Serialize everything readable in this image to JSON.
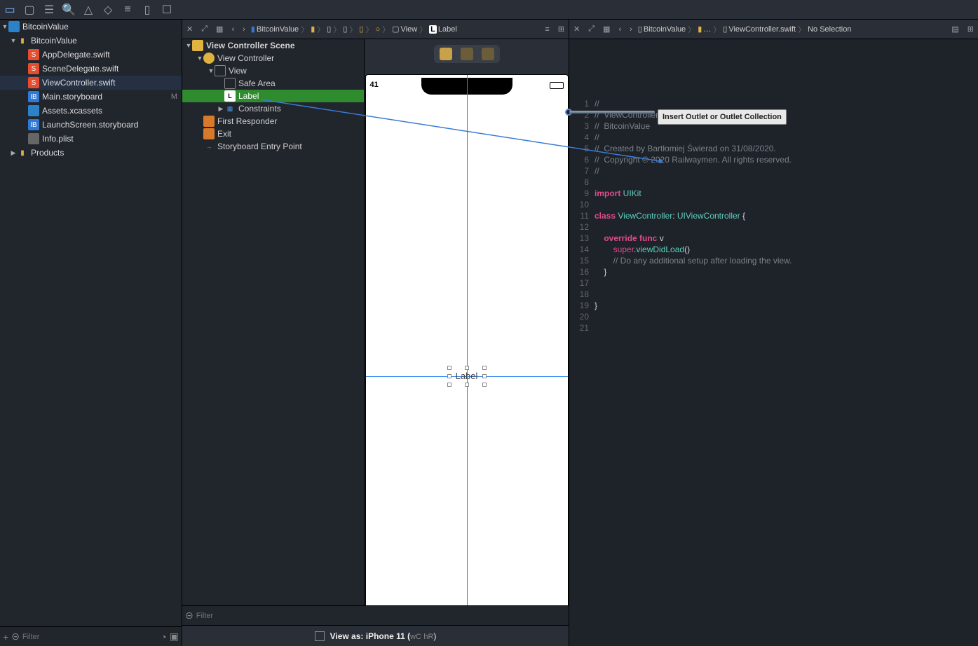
{
  "toolbar": {
    "icons": [
      "run-icon",
      "grid-icon",
      "hierarchy-icon",
      "search-icon",
      "warning-icon",
      "diamond-icon",
      "lines-icon",
      "box-icon",
      "chat-icon"
    ]
  },
  "navigator": {
    "project": "BitcoinValue",
    "groups": [
      {
        "name": "BitcoinValue",
        "expanded": true,
        "children": [
          {
            "name": "AppDelegate.swift",
            "kind": "swift"
          },
          {
            "name": "SceneDelegate.swift",
            "kind": "swift"
          },
          {
            "name": "ViewController.swift",
            "kind": "swift",
            "selected": true
          },
          {
            "name": "Main.storyboard",
            "kind": "xib",
            "status": "M"
          },
          {
            "name": "Assets.xcassets",
            "kind": "assets"
          },
          {
            "name": "LaunchScreen.storyboard",
            "kind": "xib"
          },
          {
            "name": "Info.plist",
            "kind": "plist"
          }
        ]
      },
      {
        "name": "Products",
        "expanded": false
      }
    ],
    "filter_placeholder": "Filter"
  },
  "ib": {
    "crumbs": [
      "BitcoinValue",
      "",
      "",
      "",
      "",
      "",
      "",
      "View",
      "Label"
    ],
    "outline": {
      "scene": "View Controller Scene",
      "vc": "View Controller",
      "view": "View",
      "safe": "Safe Area",
      "label": "Label",
      "constraints": "Constraints",
      "first_responder": "First Responder",
      "exit": "Exit",
      "entry": "Storyboard Entry Point"
    },
    "device_clock": "41",
    "label_text": "Label",
    "bottom": {
      "viewas": "View as: iPhone 11 (",
      "wc": "wC",
      "hr": "hR",
      "close": ")"
    },
    "filter_placeholder": "Filter"
  },
  "editor": {
    "crumbs": [
      "BitcoinValue",
      "…",
      "",
      "ViewController.swift",
      "No Selection"
    ],
    "lines": [
      {
        "n": 1,
        "t": "//",
        "cls": "comment"
      },
      {
        "n": 2,
        "t": "//  ViewController.swift",
        "cls": "comment"
      },
      {
        "n": 3,
        "t": "//  BitcoinValue",
        "cls": "comment"
      },
      {
        "n": 4,
        "t": "//",
        "cls": "comment"
      },
      {
        "n": 5,
        "t": "//  Created by Bartłomiej Świerad on 31/08/2020.",
        "cls": "comment"
      },
      {
        "n": 6,
        "t": "//  Copyright © 2020 Railwaymen. All rights reserved.",
        "cls": "comment"
      },
      {
        "n": 7,
        "t": "//",
        "cls": "comment"
      },
      {
        "n": 8,
        "t": "",
        "cls": "plain"
      },
      {
        "n": 9,
        "seg": [
          [
            "import ",
            "keyword"
          ],
          [
            "UIKit",
            "type"
          ]
        ]
      },
      {
        "n": 10,
        "t": "",
        "cls": "plain"
      },
      {
        "n": 11,
        "seg": [
          [
            "class ",
            "keyword"
          ],
          [
            "ViewController",
            "type"
          ],
          [
            ": ",
            "plain"
          ],
          [
            "UIViewController",
            "type"
          ],
          [
            " {",
            "plain"
          ]
        ]
      },
      {
        "n": 12,
        "t": "",
        "cls": "plain"
      },
      {
        "n": 13,
        "seg": [
          [
            "    override func ",
            "keyword"
          ],
          [
            "v",
            "plain"
          ]
        ]
      },
      {
        "n": 14,
        "seg": [
          [
            "        ",
            "plain"
          ],
          [
            "super",
            "super"
          ],
          [
            ".",
            "plain"
          ],
          [
            "viewDidLoad",
            "func"
          ],
          [
            "()",
            "plain"
          ]
        ]
      },
      {
        "n": 15,
        "seg": [
          [
            "        ",
            "plain"
          ],
          [
            "// Do any additional setup after loading the view.",
            "comment"
          ]
        ]
      },
      {
        "n": 16,
        "t": "    }",
        "cls": "plain"
      },
      {
        "n": 17,
        "t": "",
        "cls": "plain"
      },
      {
        "n": 18,
        "t": "",
        "cls": "plain"
      },
      {
        "n": 19,
        "t": "}",
        "cls": "plain"
      },
      {
        "n": 20,
        "t": "",
        "cls": "plain"
      },
      {
        "n": 21,
        "t": "",
        "cls": "plain"
      }
    ],
    "outlet_tip": "Insert Outlet or Outlet Collection"
  }
}
